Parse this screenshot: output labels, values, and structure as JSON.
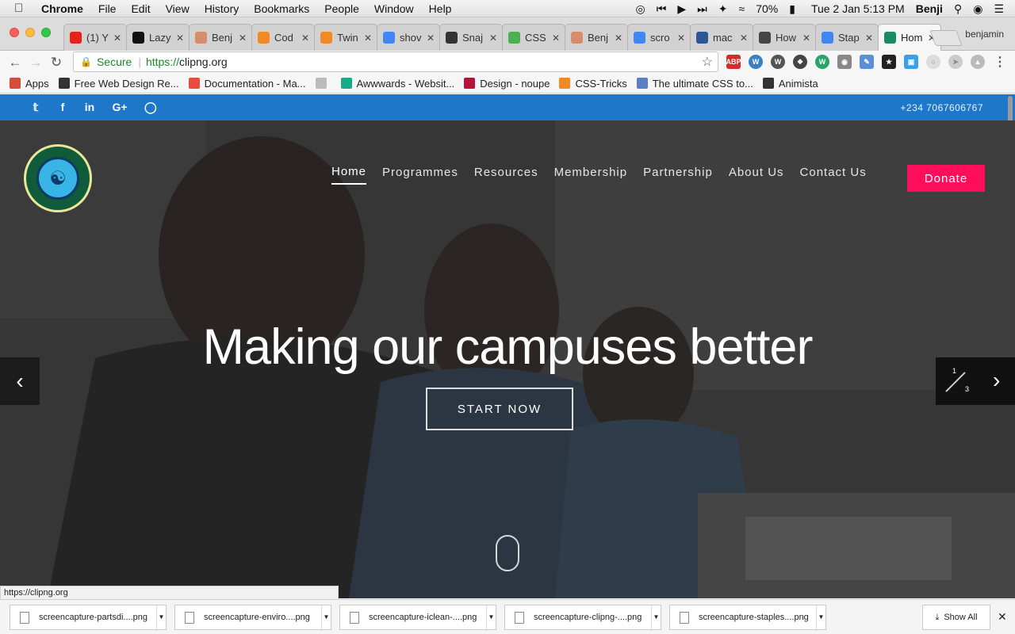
{
  "menubar": {
    "app": "Chrome",
    "items": [
      "File",
      "Edit",
      "View",
      "History",
      "Bookmarks",
      "People",
      "Window",
      "Help"
    ],
    "battery": "70%",
    "datetime": "Tue 2 Jan  5:13 PM",
    "user": "Benji"
  },
  "tabs": [
    {
      "title": "(1) Y",
      "icon": "youtube-icon",
      "color": "#e62117"
    },
    {
      "title": "Lazy",
      "icon": "tl-icon",
      "color": "#111111"
    },
    {
      "title": "Benj",
      "icon": "pin-icon",
      "color": "#d98c6b"
    },
    {
      "title": "Cod",
      "icon": "asterisk-icon",
      "color": "#f08a24"
    },
    {
      "title": "Twin",
      "icon": "asterisk-icon",
      "color": "#f08a24"
    },
    {
      "title": "shov",
      "icon": "google-icon",
      "color": "#4285f4"
    },
    {
      "title": "Snaj",
      "icon": "snap-icon",
      "color": "#333333"
    },
    {
      "title": "CSS",
      "icon": "w3-icon",
      "color": "#4caf50"
    },
    {
      "title": "Benj",
      "icon": "pin-icon",
      "color": "#d98c6b"
    },
    {
      "title": "scro",
      "icon": "google-icon",
      "color": "#4285f4"
    },
    {
      "title": "mac",
      "icon": "bracket-icon",
      "color": "#2b5797"
    },
    {
      "title": "How",
      "icon": "hbox-icon",
      "color": "#444444"
    },
    {
      "title": "Stap",
      "icon": "loading-icon",
      "color": "#4285f4"
    },
    {
      "title": "Hom",
      "icon": "site-icon",
      "color": "#1a8a6b"
    }
  ],
  "profile": "benjamin",
  "omnibox": {
    "secure": "Secure",
    "scheme": "https://",
    "host": "clipng.org"
  },
  "bookmarks": [
    {
      "label": "Apps",
      "color": "#d64c3b"
    },
    {
      "label": "Free Web Design Re...",
      "color": "#333333"
    },
    {
      "label": "Documentation - Ma...",
      "color": "#e74c3c"
    },
    {
      "label": "",
      "color": "#bbbbbb"
    },
    {
      "label": "Awwwards - Websit...",
      "color": "#1aaa8a"
    },
    {
      "label": "Design - noupe",
      "color": "#b8123a"
    },
    {
      "label": "CSS-Tricks",
      "color": "#f08a24"
    },
    {
      "label": "The ultimate CSS to...",
      "color": "#5b7fc4"
    },
    {
      "label": "Animista",
      "color": "#333333"
    }
  ],
  "site": {
    "phone": "+234 7067606767",
    "social": [
      "twitter-icon",
      "facebook-icon",
      "linkedin-icon",
      "google-plus-icon",
      "instagram-icon"
    ],
    "nav": [
      "Home",
      "Programmes",
      "Resources",
      "Membership",
      "Partnership",
      "About Us",
      "Contact Us"
    ],
    "donate": "Donate",
    "headline": "Making our campuses better",
    "cta": "START NOW",
    "slide_current": "1",
    "slide_total": "3",
    "brand_color": "#1e77c8",
    "accent_color": "#ff0e5c"
  },
  "status_url": "https://clipng.org",
  "downloads": [
    "screencapture-partsdi....png",
    "screencapture-enviro....png",
    "screencapture-iclean-....png",
    "screencapture-clipng-....png",
    "screencapture-staples....png"
  ],
  "show_all": "Show All"
}
